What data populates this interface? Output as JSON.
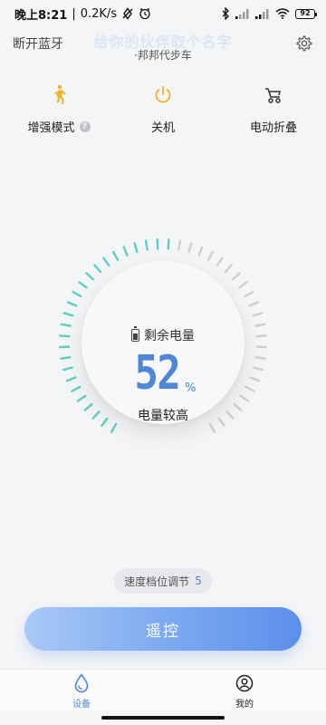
{
  "status_bar": {
    "time": "晚上8:21",
    "network_speed": "0.2K/s",
    "battery_level": "92"
  },
  "header": {
    "disconnect_label": "断开蓝牙",
    "watermark_title": "给你的伙伴取个名字",
    "device_name": "·邦邦代步车",
    "settings_icon": "gear-icon"
  },
  "actions": [
    {
      "label": "增强模式",
      "icon": "walking-person-icon",
      "color": "#f0b323",
      "has_help": true,
      "help_glyph": "?"
    },
    {
      "label": "关机",
      "icon": "power-icon",
      "color": "#f0b323",
      "has_help": false
    },
    {
      "label": "电动折叠",
      "icon": "stroller-fold-icon",
      "color": "#333333",
      "has_help": false
    }
  ],
  "gauge": {
    "label": "剩余电量",
    "value": "52",
    "unit": "%",
    "percent": 52,
    "status": "电量较高",
    "active_color": "#5ad1c4",
    "inactive_color": "#cfcfcf"
  },
  "speed": {
    "label": "速度档位调节",
    "value": "5"
  },
  "remote_button": {
    "label": "遥控"
  },
  "tabbar": {
    "items": [
      {
        "label": "设备",
        "icon": "droplet-icon",
        "active": true
      },
      {
        "label": "我的",
        "icon": "user-icon",
        "active": false
      }
    ],
    "active_color": "#4f86d6"
  }
}
